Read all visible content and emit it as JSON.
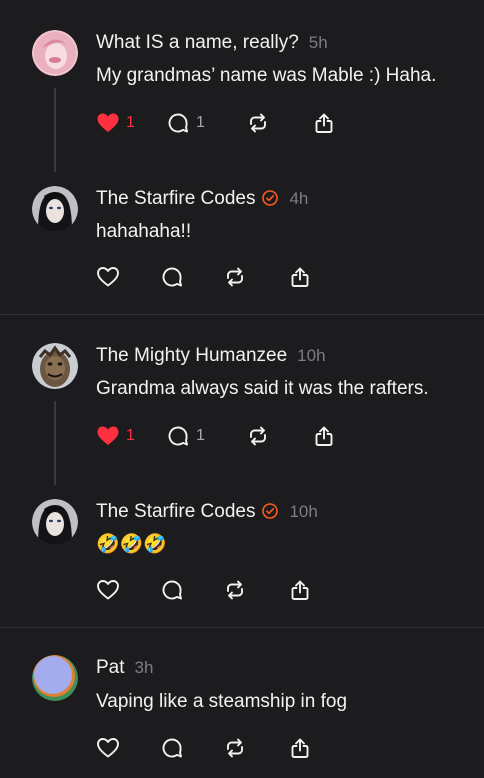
{
  "posts": [
    {
      "author": "What IS a name, really?",
      "time": "5h",
      "verified": false,
      "text": "My grandmas’ name was Mable :) Haha.",
      "liked": true,
      "likes": "1",
      "replies": "1",
      "avatar_color": "#e7a3b4"
    },
    {
      "author": "The Starfire Codes",
      "time": "4h",
      "verified": true,
      "text": "hahahaha!!",
      "liked": false,
      "likes": "",
      "replies": "",
      "avatar_color": "#2b2b2f"
    },
    {
      "author": "The Mighty Humanzee",
      "time": "10h",
      "verified": false,
      "text": "Grandma always said it was the rafters.",
      "liked": true,
      "likes": "1",
      "replies": "1",
      "avatar_color": "#6a5a48"
    },
    {
      "author": "The Starfire Codes",
      "time": "10h",
      "verified": true,
      "text": "🤣🤣🤣",
      "liked": false,
      "likes": "",
      "replies": "",
      "avatar_color": "#2b2b2f"
    },
    {
      "author": "Pat",
      "time": "3h",
      "verified": false,
      "text": "Vaping like a steamship in fog",
      "liked": false,
      "likes": "",
      "replies": "",
      "avatar_color": "#9aa7e6"
    }
  ],
  "colors": {
    "background": "#1c1c1e",
    "like": "#ff3040",
    "verified": "#ff5a1f",
    "muted": "#7d7d80"
  },
  "icons": [
    "heart-icon",
    "comment-icon",
    "repost-icon",
    "share-icon",
    "verified-badge-icon"
  ]
}
